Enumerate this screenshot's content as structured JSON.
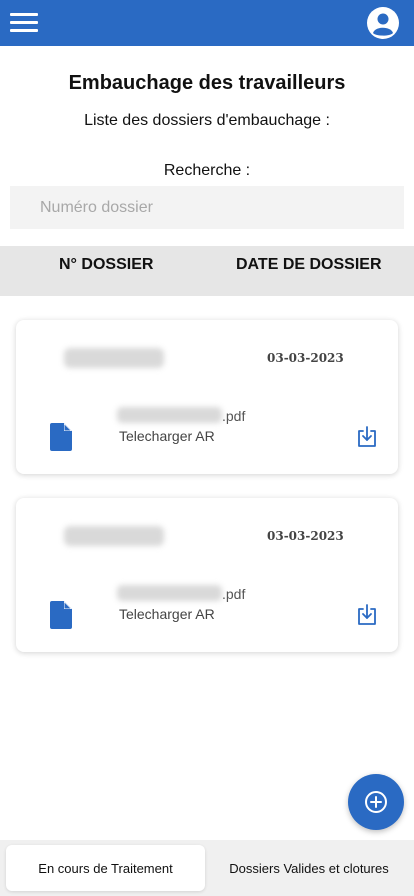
{
  "header": {
    "menu_icon": "hamburger-menu-icon",
    "profile_icon": "account-circle-icon",
    "background": "#2a6ac3"
  },
  "page": {
    "title": "Embauchage des travailleurs",
    "subtitle": "Liste des dossiers d'embauchage :"
  },
  "search": {
    "label": "Recherche :",
    "placeholder": "Numéro dossier",
    "value": ""
  },
  "table": {
    "columns": [
      "N° DOSSIER",
      "DATE DE DOSSIER"
    ]
  },
  "dossiers": [
    {
      "numero": "",
      "date": "03-03-2023",
      "file_ext": ".pdf",
      "download_label": "Telecharger AR",
      "file_icon": "document-icon",
      "action_icon": "download-icon"
    },
    {
      "numero": "",
      "date": "03-03-2023",
      "file_ext": ".pdf",
      "download_label": "Telecharger AR",
      "file_icon": "document-icon",
      "action_icon": "download-icon"
    }
  ],
  "fab": {
    "icon": "add-circle-icon"
  },
  "tabs": [
    {
      "label": "En cours de Traitement",
      "active": true
    },
    {
      "label": "Dossiers Valides et clotures",
      "active": false
    }
  ],
  "colors": {
    "primary": "#2a6ac3",
    "header_row": "#e6e6e6",
    "search_bg": "#f3f3f3"
  }
}
